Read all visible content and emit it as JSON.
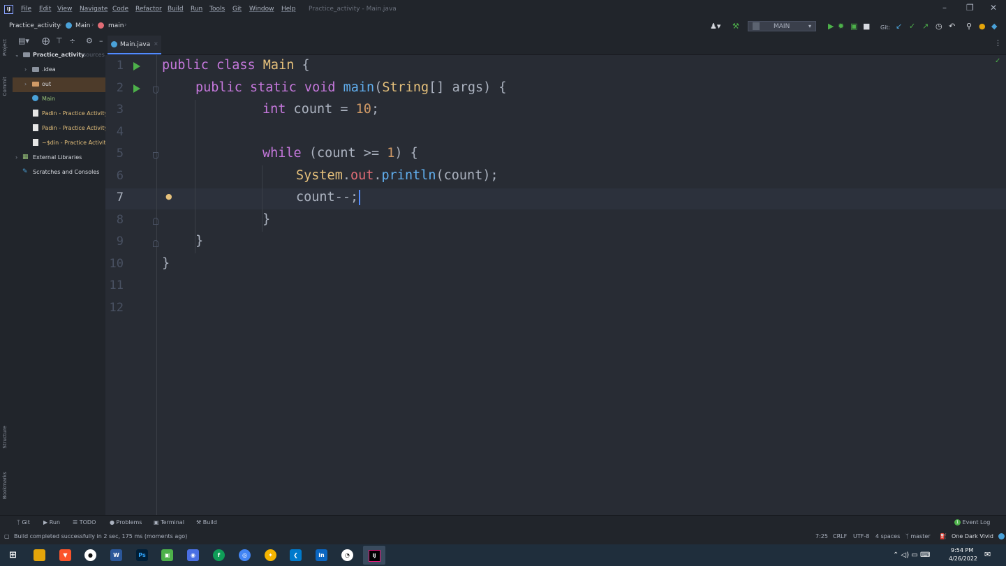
{
  "menu": {
    "items": [
      "File",
      "Edit",
      "View",
      "Navigate",
      "Code",
      "Refactor",
      "Build",
      "Run",
      "Tools",
      "Git",
      "Window",
      "Help"
    ],
    "window_title": "Practice_activity - Main.java",
    "window_buttons": [
      "–",
      "❐",
      "✕"
    ]
  },
  "breadcrumb": {
    "project": "Practice_activity",
    "class": "Main",
    "method": "main"
  },
  "toolbar": {
    "run_config": "MAIN",
    "git_label": "Git:"
  },
  "side_tabs": {
    "project": "Project",
    "commit": "Commit",
    "structure": "Structure",
    "bookmarks": "Bookmarks"
  },
  "project_tree": {
    "root": "Practice_activity",
    "root_suffix": "sources",
    "items": [
      {
        "label": ".idea"
      },
      {
        "label": "out"
      },
      {
        "label": "Main"
      },
      {
        "label": "Padin - Practice Activity"
      },
      {
        "label": "Padin - Practice Activity"
      },
      {
        "label": "~$din - Practice Activity"
      }
    ],
    "external_libraries": "External Libraries",
    "scratches": "Scratches and Consoles"
  },
  "tabs": [
    {
      "label": "Main.java"
    }
  ],
  "editor": {
    "line_numbers": [
      "1",
      "2",
      "3",
      "4",
      "5",
      "6",
      "7",
      "8",
      "9",
      "10",
      "11",
      "12"
    ],
    "code": {
      "l1_kw": "public class ",
      "l1_cls": "Main",
      "l1_rest": " {",
      "l2_kw": "public static void ",
      "l2_fn": "main",
      "l2_p1": "(",
      "l2_cls": "String",
      "l2_p2": "[] args) {",
      "l3_kw": "int",
      "l3_mid": " count = ",
      "l3_num": "10",
      "l3_end": ";",
      "l5_kw": "while",
      "l5_mid": " (count >= ",
      "l5_num": "1",
      "l5_end": ") {",
      "l6_cls": "System",
      "l6_dot1": ".",
      "l6_fld": "out",
      "l6_dot2": ".",
      "l6_fn": "println",
      "l6_end": "(count);",
      "l7": "count--;",
      "l8": "}",
      "l9": "}",
      "l10": "}"
    }
  },
  "tool_windows": {
    "git": "Git",
    "run": "Run",
    "todo": "TODO",
    "problems": "Problems",
    "terminal": "Terminal",
    "build": "Build",
    "event_log": "Event Log",
    "event_count": "1"
  },
  "status": {
    "message": "Build completed successfully in 2 sec, 175 ms (moments ago)",
    "position": "7:25",
    "line_sep": "CRLF",
    "encoding": "UTF-8",
    "indent": "4 spaces",
    "branch": "master",
    "theme": "One Dark Vivid"
  },
  "taskbar": {
    "time": "9:54 PM",
    "date": "4/26/2022"
  },
  "colors": {
    "keyword": "#c678dd",
    "class": "#e5c07b",
    "function": "#61afef",
    "number": "#d19a66",
    "field": "#e06c75",
    "editor_bg": "#282c34",
    "run_green": "#4db14a"
  }
}
